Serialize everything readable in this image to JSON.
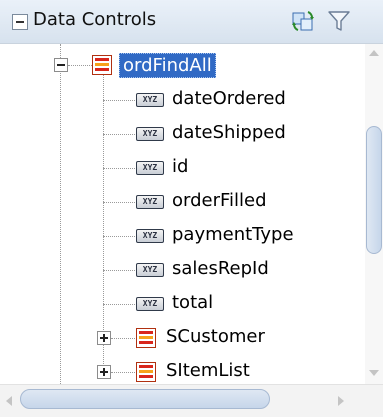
{
  "panel": {
    "title": "Data Controls",
    "collapse_icon": "collapse-icon",
    "toolbar": {
      "refresh_icon": "refresh-icon",
      "filter_icon": "filter-icon"
    }
  },
  "tree": {
    "root": {
      "label": "ordFindAll",
      "icon": "collection-icon",
      "expanded": true,
      "selected": true
    },
    "attributes": [
      {
        "label": "dateOrdered",
        "icon": "xyz-attribute-icon",
        "badge": "XYZ"
      },
      {
        "label": "dateShipped",
        "icon": "xyz-attribute-icon",
        "badge": "XYZ"
      },
      {
        "label": "id",
        "icon": "xyz-attribute-icon",
        "badge": "XYZ"
      },
      {
        "label": "orderFilled",
        "icon": "xyz-attribute-icon",
        "badge": "XYZ"
      },
      {
        "label": "paymentType",
        "icon": "xyz-attribute-icon",
        "badge": "XYZ"
      },
      {
        "label": "salesRepId",
        "icon": "xyz-attribute-icon",
        "badge": "XYZ"
      },
      {
        "label": "total",
        "icon": "xyz-attribute-icon",
        "badge": "XYZ"
      }
    ],
    "children": [
      {
        "label": "SCustomer",
        "icon": "collection-icon",
        "expanded": false
      },
      {
        "label": "SItemList",
        "icon": "collection-icon",
        "expanded": false
      }
    ]
  },
  "colors": {
    "selection": "#316ac5",
    "header_gradient_top": "#eaf1f9",
    "collection_red": "#d9261c",
    "collection_orange": "#f7a21a"
  }
}
